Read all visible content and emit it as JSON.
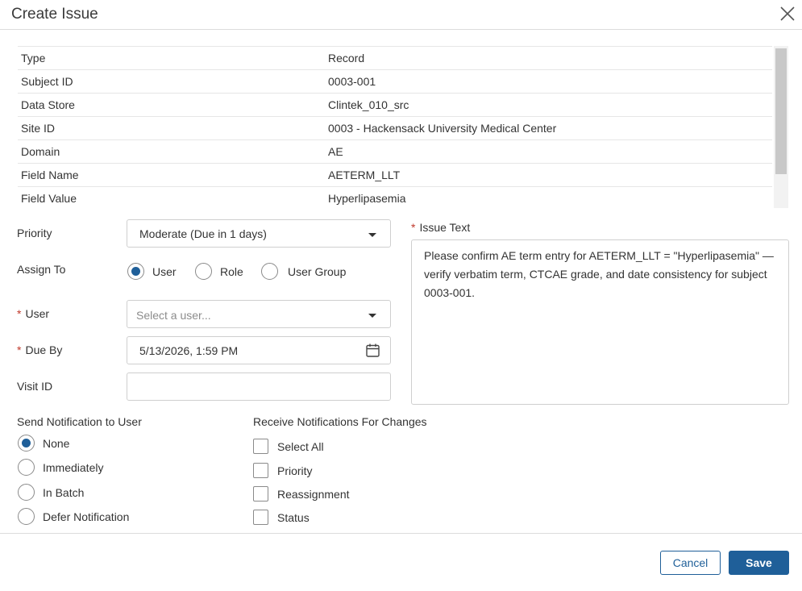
{
  "dialog": {
    "title": "Create Issue"
  },
  "details": [
    {
      "key": "Type",
      "value": "Record"
    },
    {
      "key": "Subject ID",
      "value": "0003-001"
    },
    {
      "key": "Data Store",
      "value": "Clintek_010_src"
    },
    {
      "key": "Site ID",
      "value": "0003 - Hackensack University Medical Center"
    },
    {
      "key": "Domain",
      "value": "AE"
    },
    {
      "key": "Field Name",
      "value": "AETERM_LLT"
    },
    {
      "key": "Field Value",
      "value": "Hyperlipasemia"
    }
  ],
  "form": {
    "priority": {
      "label": "Priority",
      "value": "Moderate (Due in 1 days)"
    },
    "assign_to": {
      "label": "Assign To",
      "options": [
        "User",
        "Role",
        "User Group"
      ],
      "selected": "User"
    },
    "user": {
      "required_mark": "*",
      "label": "User",
      "placeholder": "Select a user..."
    },
    "due_by": {
      "required_mark": "*",
      "label": "Due By",
      "value": "5/13/2026, 1:59 PM"
    },
    "visit_id": {
      "label": "Visit ID",
      "value": ""
    },
    "issue_text": {
      "required_mark": "*",
      "label": "Issue Text",
      "value": "Please confirm AE term entry for AETERM_LLT = \"Hyperlipasemia\" — verify verbatim term, CTCAE grade, and date consistency for subject 0003-001."
    }
  },
  "send_notification": {
    "label": "Send Notification to User",
    "options": [
      "None",
      "Immediately",
      "In Batch",
      "Defer Notification"
    ],
    "selected": "None"
  },
  "receive_notifications": {
    "label": "Receive Notifications For Changes",
    "options": [
      "Select All",
      "Priority",
      "Reassignment",
      "Status"
    ]
  },
  "footer": {
    "cancel_label": "Cancel",
    "save_label": "Save"
  },
  "colors": {
    "accent": "#1f5f99",
    "required": "#c0392b",
    "border": "#cfcfcf"
  },
  "icons": {
    "close": "close-icon",
    "dropdown": "chevron-down-icon",
    "calendar": "calendar-icon"
  }
}
